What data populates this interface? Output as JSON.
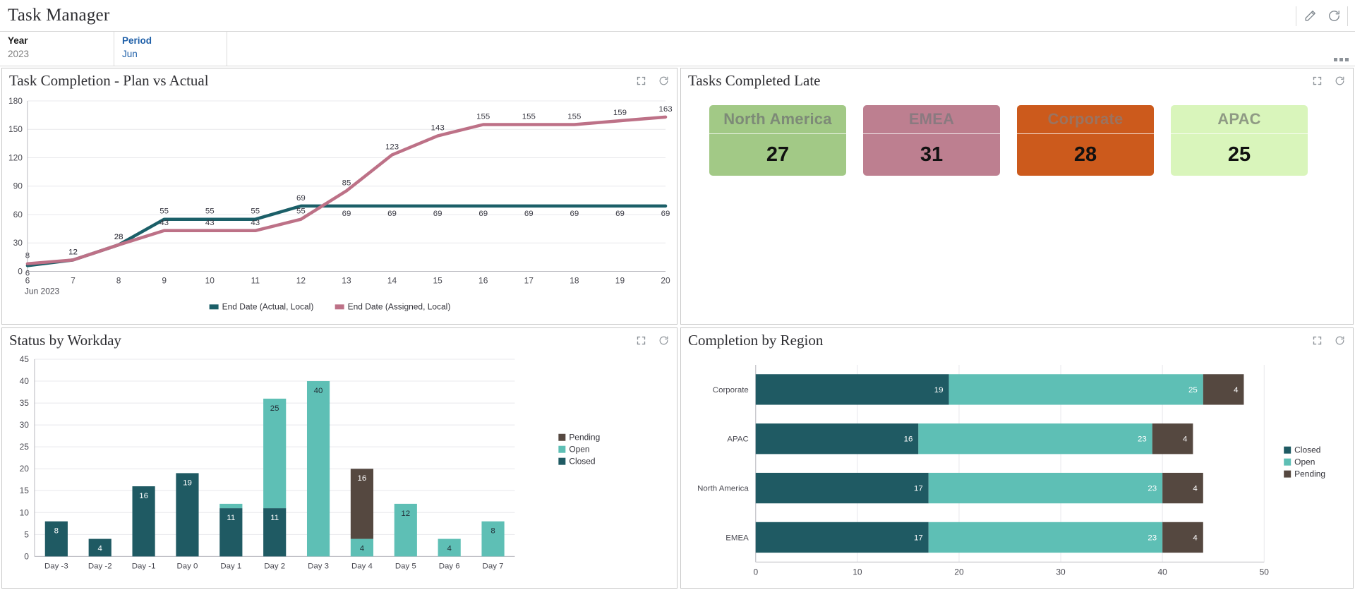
{
  "app": {
    "title": "Task Manager",
    "actions": [
      {
        "name": "edit-icon",
        "label": "Edit"
      },
      {
        "name": "refresh-icon",
        "label": "Refresh"
      }
    ],
    "overflow_label": "More options"
  },
  "filters": [
    {
      "label": "Year",
      "value": "2023",
      "accent": false
    },
    {
      "label": "Period",
      "value": "Jun",
      "accent": true
    }
  ],
  "colors": {
    "closed": "#1f5a63",
    "open": "#5ebfb5",
    "pending": "#554840",
    "actual_line": "#1b5f68",
    "assigned_line": "#bd7187",
    "kpi_green": "#a2c986",
    "kpi_mauve": "#bd7f90",
    "kpi_orange": "#cc5a1c",
    "kpi_lightgreen": "#d9f5bb"
  },
  "panels": {
    "plan_vs_actual": {
      "title": "Task Completion - Plan vs Actual",
      "expand_label": "Expand",
      "refresh_label": "Refresh"
    },
    "tasks_late": {
      "title": "Tasks Completed Late",
      "expand_label": "Expand",
      "refresh_label": "Refresh",
      "cards": [
        {
          "label": "North America",
          "value": "27",
          "color": "#a2c986",
          "title_color": "#7d8a77"
        },
        {
          "label": "EMEA",
          "value": "31",
          "color": "#bd7f90",
          "title_color": "#8a7a80"
        },
        {
          "label": "Corporate",
          "value": "28",
          "color": "#cc5a1c",
          "title_color": "#9b7360"
        },
        {
          "label": "APAC",
          "value": "25",
          "color": "#d9f5bb",
          "title_color": "#8f9a84"
        }
      ]
    },
    "status_by_workday": {
      "title": "Status by Workday",
      "expand_label": "Expand",
      "refresh_label": "Refresh"
    },
    "completion_by_region": {
      "title": "Completion by Region",
      "expand_label": "Expand",
      "refresh_label": "Refresh"
    }
  },
  "chart_data": [
    {
      "id": "plan_vs_actual",
      "type": "line",
      "title": "Task Completion - Plan vs Actual",
      "xlabel": "Jun 2023",
      "ylabel": "",
      "x": [
        6,
        7,
        8,
        9,
        10,
        11,
        12,
        13,
        14,
        15,
        16,
        17,
        18,
        19,
        20
      ],
      "xticks": [
        "6",
        "7",
        "8",
        "9",
        "10",
        "11",
        "12",
        "13",
        "14",
        "15",
        "16",
        "17",
        "18",
        "19",
        "20"
      ],
      "xaxis_caption": "Jun 2023",
      "yticks": [
        0,
        30,
        60,
        90,
        120,
        150,
        180
      ],
      "ylim": [
        0,
        180
      ],
      "grid": true,
      "legend_position": "bottom",
      "series": [
        {
          "name": "End Date (Actual, Local)",
          "color": "#1b5f68",
          "values": [
            6,
            12,
            28,
            55,
            55,
            55,
            69,
            69,
            69,
            69,
            69,
            69,
            69,
            69,
            69
          ]
        },
        {
          "name": "End Date (Assigned, Local)",
          "color": "#bd7187",
          "values": [
            8,
            12,
            28,
            43,
            43,
            43,
            55,
            85,
            123,
            143,
            155,
            155,
            155,
            159,
            163
          ]
        }
      ]
    },
    {
      "id": "status_by_workday",
      "type": "bar",
      "stacked": true,
      "title": "Status by Workday",
      "xlabel": "",
      "ylabel": "",
      "categories": [
        "Day -3",
        "Day -2",
        "Day -1",
        "Day 0",
        "Day 1",
        "Day 2",
        "Day 3",
        "Day 4",
        "Day 5",
        "Day 6",
        "Day 7"
      ],
      "yticks": [
        0,
        5,
        10,
        15,
        20,
        25,
        30,
        35,
        40,
        45
      ],
      "ylim": [
        0,
        45
      ],
      "grid": true,
      "legend_position": "right",
      "series": [
        {
          "name": "Closed",
          "color": "#1f5a63",
          "values": [
            8,
            4,
            16,
            19,
            11,
            11,
            0,
            0,
            0,
            0,
            0
          ]
        },
        {
          "name": "Open",
          "color": "#5ebfb5",
          "values": [
            0,
            0,
            0,
            0,
            1,
            25,
            40,
            4,
            12,
            4,
            8
          ]
        },
        {
          "name": "Pending",
          "color": "#554840",
          "values": [
            0,
            0,
            0,
            0,
            0,
            0,
            0,
            16,
            0,
            0,
            0
          ]
        }
      ],
      "legend_order": [
        "Pending",
        "Open",
        "Closed"
      ]
    },
    {
      "id": "completion_by_region",
      "type": "bar",
      "orientation": "horizontal",
      "stacked": true,
      "title": "Completion by Region",
      "xlabel": "",
      "ylabel": "",
      "categories": [
        "Corporate",
        "APAC",
        "North America",
        "EMEA"
      ],
      "xticks": [
        0,
        10,
        20,
        30,
        40,
        50
      ],
      "xlim": [
        0,
        50
      ],
      "grid": true,
      "legend_position": "right",
      "series": [
        {
          "name": "Closed",
          "color": "#1f5a63",
          "values": [
            19,
            16,
            17,
            17
          ]
        },
        {
          "name": "Open",
          "color": "#5ebfb5",
          "values": [
            25,
            23,
            23,
            23
          ]
        },
        {
          "name": "Pending",
          "color": "#554840",
          "values": [
            4,
            4,
            4,
            4
          ]
        }
      ],
      "legend_order": [
        "Closed",
        "Open",
        "Pending"
      ]
    }
  ]
}
